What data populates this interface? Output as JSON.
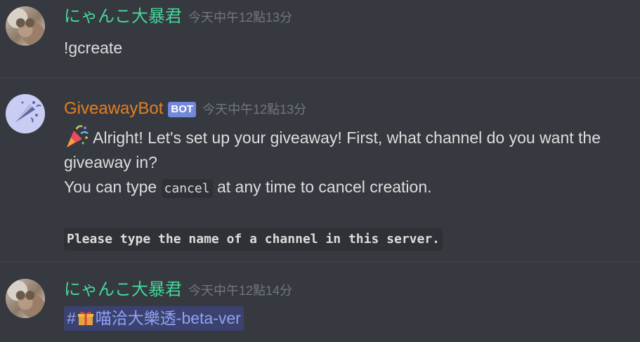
{
  "messages": [
    {
      "username": "にゃんこ大暴君",
      "timestamp": "今天中午12點13分",
      "content": "!gcreate"
    },
    {
      "username": "GiveawayBot",
      "bot_tag": "BOT",
      "timestamp": "今天中午12點13分",
      "line1": "Alright! Let's set up your giveaway! First, what channel do you want the",
      "line2": "giveaway in?",
      "line3_prefix": "You can type",
      "line3_code": "cancel",
      "line3_suffix": "at any time to cancel creation.",
      "codeblock": "Please type the name of a channel in this server."
    },
    {
      "username": "にゃんこ大暴君",
      "timestamp": "今天中午12點14分",
      "channel_hash": "#",
      "channel_name": "喵洽大樂透-beta-ver"
    }
  ],
  "colors": {
    "background": "#36393f",
    "username_user": "#43d79a",
    "username_bot": "#e67e22",
    "bot_tag": "#7289da",
    "mention": "#8fa1f2"
  },
  "icons": [
    "cat-avatar-icon",
    "bot-avatar-icon",
    "party-popper-icon",
    "gift-icon"
  ]
}
